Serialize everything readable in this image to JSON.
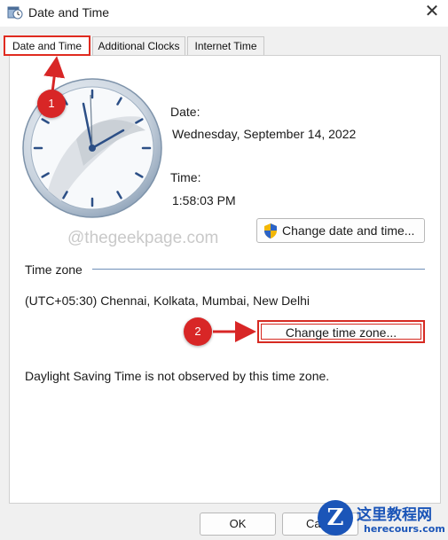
{
  "window": {
    "title": "Date and Time",
    "close_glyph": "✕"
  },
  "tabs": [
    {
      "label": "Date and Time",
      "selected": true
    },
    {
      "label": "Additional Clocks",
      "selected": false
    },
    {
      "label": "Internet Time",
      "selected": false
    }
  ],
  "datetime": {
    "date_label": "Date:",
    "date_value": "Wednesday, September 14, 2022",
    "time_label": "Time:",
    "time_value": "1:58:03 PM",
    "change_button": "Change date and time..."
  },
  "timezone": {
    "section_label": "Time zone",
    "value": "(UTC+05:30) Chennai, Kolkata, Mumbai, New Delhi",
    "change_button": "Change time zone...",
    "dst_text": "Daylight Saving Time is not observed by this time zone."
  },
  "footer": {
    "ok_label": "OK",
    "cancel_label": "Ca"
  },
  "watermark": "@thegeekpage.com",
  "annotations": {
    "badge1": "1",
    "badge2": "2",
    "color": "#d82626"
  },
  "corner_logo": {
    "glyph": "Z",
    "name": "这里教程网",
    "url": "herecours.com"
  },
  "icons": [
    "calendar-clock-icon",
    "close-icon",
    "shield-icon"
  ]
}
